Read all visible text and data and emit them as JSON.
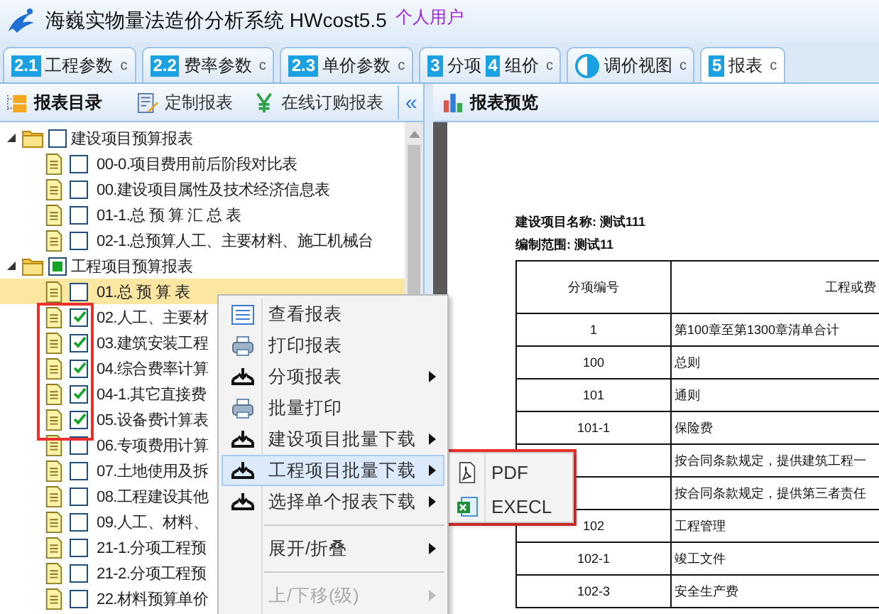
{
  "window": {
    "title": "海巍实物量法造价分析系统 HWcost5.5",
    "edition": "个人用户"
  },
  "tabs": [
    {
      "kind": "badge",
      "badges": [
        {
          "num": "2.1",
          "label": "工程参数"
        }
      ],
      "refresh": "c",
      "selected": false
    },
    {
      "kind": "badge",
      "badges": [
        {
          "num": "2.2",
          "label": "费率参数"
        }
      ],
      "refresh": "c",
      "selected": false
    },
    {
      "kind": "badge",
      "badges": [
        {
          "num": "2.3",
          "label": "单价参数"
        }
      ],
      "refresh": "c",
      "selected": false
    },
    {
      "kind": "badge",
      "badges": [
        {
          "num": "3",
          "label": "分项"
        },
        {
          "num": "4",
          "label": "组价"
        }
      ],
      "refresh": "c",
      "selected": false
    },
    {
      "kind": "icon",
      "badges": [
        {
          "label": "调价视图"
        }
      ],
      "refresh": "c",
      "selected": false
    },
    {
      "kind": "badge",
      "badges": [
        {
          "num": "5",
          "label": "报表"
        }
      ],
      "refresh": "c",
      "selected": true
    }
  ],
  "left_toolbar": {
    "title": "报表目录",
    "custom": "定制报表",
    "order": "在线订购报表",
    "collapse": "«"
  },
  "tree": [
    {
      "label": "建设项目预算报表",
      "expanded": true,
      "checked": false,
      "partial": false,
      "selected": false,
      "children": [
        {
          "label": "00-0.项目费用前后阶段对比表",
          "checked": false,
          "selected": false
        },
        {
          "label": "00.建设项目属性及技术经济信息表",
          "checked": false,
          "selected": false
        },
        {
          "label": "01-1.总 预 算 汇 总 表",
          "checked": false,
          "selected": false
        },
        {
          "label": "02-1.总预算人工、主要材料、施工机械台",
          "checked": false,
          "selected": false
        }
      ]
    },
    {
      "label": "工程项目预算报表",
      "expanded": true,
      "checked": false,
      "partial": true,
      "selected": false,
      "children": [
        {
          "label": "01.总 预 算 表",
          "checked": false,
          "selected": true
        },
        {
          "label": "02.人工、主要材",
          "checked": true,
          "selected": false
        },
        {
          "label": "03.建筑安装工程",
          "checked": true,
          "selected": false
        },
        {
          "label": "04.综合费率计算",
          "checked": true,
          "selected": false
        },
        {
          "label": "04-1.其它直接费",
          "checked": true,
          "selected": false
        },
        {
          "label": "05.设备费计算表",
          "checked": true,
          "selected": false
        },
        {
          "label": "06.专项费用计算",
          "checked": false,
          "selected": false
        },
        {
          "label": "07.土地使用及拆",
          "checked": false,
          "selected": false
        },
        {
          "label": "08.工程建设其他",
          "checked": false,
          "selected": false
        },
        {
          "label": "09.人工、材料、",
          "checked": false,
          "selected": false
        },
        {
          "label": "21-1.分项工程预",
          "checked": false,
          "selected": false
        },
        {
          "label": "21-2.分项工程预",
          "checked": false,
          "selected": false
        },
        {
          "label": "22.材料预算单价",
          "checked": false,
          "selected": false
        }
      ]
    }
  ],
  "preview": {
    "title": "报表预览",
    "project_name": "建设项目名称: 测试111",
    "scope": "编制范围: 测试11",
    "table": {
      "columns": [
        "分项编号",
        "工程或费"
      ],
      "rows": [
        {
          "code": "1",
          "name": "第100章至第1300章清单合计"
        },
        {
          "code": "100",
          "name": "总则"
        },
        {
          "code": "101",
          "name": "通则"
        },
        {
          "code": "101-1",
          "name": "保险费"
        },
        {
          "name": "按合同条款规定，提供建筑工程一"
        },
        {
          "name": "按合同条款规定，提供第三者责任"
        },
        {
          "code": "102",
          "name": "工程管理"
        },
        {
          "code": "102-1",
          "name": "竣工文件"
        },
        {
          "code": "102-3",
          "name": "安全生产费"
        }
      ]
    }
  },
  "context_menu": {
    "items": [
      {
        "kind": "list",
        "label": "查看报表",
        "submenu": false,
        "selected": false,
        "disabled": false
      },
      {
        "kind": "print",
        "label": "打印报表",
        "submenu": false,
        "selected": false,
        "disabled": false
      },
      {
        "kind": "download",
        "label": "分项报表",
        "submenu": true,
        "selected": false,
        "disabled": false
      },
      {
        "kind": "print",
        "label": "批量打印",
        "submenu": false,
        "selected": false,
        "disabled": false
      },
      {
        "kind": "download",
        "label": "建设项目批量下载",
        "submenu": true,
        "selected": false,
        "disabled": false
      },
      {
        "kind": "download",
        "label": "工程项目批量下载",
        "submenu": true,
        "selected": true,
        "disabled": false
      },
      {
        "kind": "download",
        "label": "选择单个报表下载",
        "submenu": true,
        "selected": false,
        "disabled": false
      },
      {
        "kind": "separator"
      },
      {
        "kind": "plain",
        "label": "展开/折叠",
        "submenu": true,
        "selected": false,
        "disabled": false
      },
      {
        "kind": "separator"
      },
      {
        "kind": "plain",
        "label": "上/下移(级)",
        "submenu": true,
        "selected": false,
        "disabled": true
      }
    ]
  },
  "submenu": {
    "items": [
      {
        "kind": "pdf",
        "label": "PDF",
        "selected": false
      },
      {
        "kind": "excel",
        "label": "EXECL",
        "selected": false
      }
    ]
  },
  "annotations": [
    {
      "kind": "frame"
    },
    {
      "kind": "frame"
    }
  ]
}
